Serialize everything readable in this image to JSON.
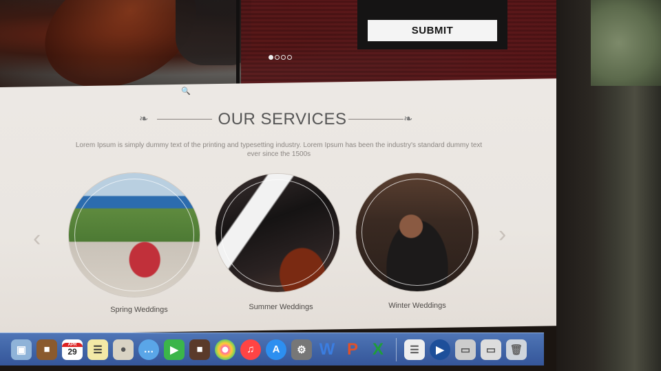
{
  "hero": {
    "submit_label": "SUBMIT",
    "slider_dots": 4,
    "active_dot": 1
  },
  "services": {
    "title": "OUR SERVICES",
    "intro": "Lorem Ipsum is simply dummy text of the printing and typesetting industry. Lorem Ipsum has been the industry's standard dummy text ever since the 1500s",
    "items": [
      {
        "label": "Spring Weddings"
      },
      {
        "label": "Summer Weddings"
      },
      {
        "label": "Winter Weddings"
      }
    ]
  },
  "dock": {
    "calendar_month": "APR",
    "calendar_day": "29",
    "word_letter": "W",
    "powerpoint_letter": "P",
    "excel_letter": "X"
  },
  "colors": {
    "section_bg": "#ece8e4",
    "title_text": "#555555",
    "dock_blue": "#3e62a4"
  }
}
